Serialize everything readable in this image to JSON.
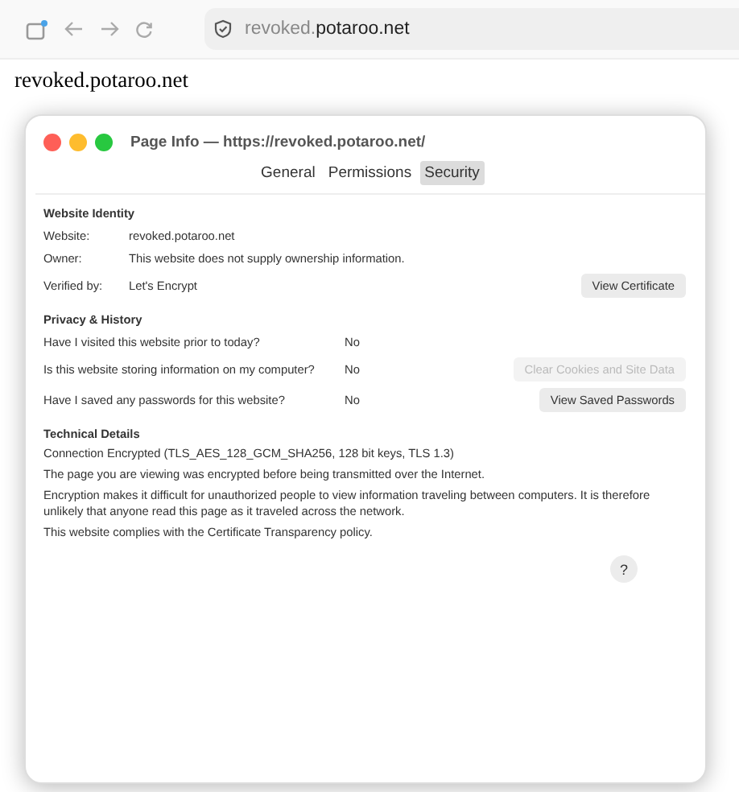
{
  "toolbar": {
    "address": "revoked.**potaroo.net**"
  },
  "page_heading": "revoked.potaroo.net",
  "dialog": {
    "title": "Page Info — https://revoked.potaroo.net/",
    "tabs": [
      {
        "label": "General",
        "selected": false
      },
      {
        "label": "Permissions",
        "selected": false
      },
      {
        "label": "Security",
        "selected": true
      }
    ],
    "identity": {
      "heading": "Website Identity",
      "rows": [
        {
          "label": "Website:",
          "value": "revoked.potaroo.net"
        },
        {
          "label": "Owner:",
          "value": "This website does not supply ownership information."
        },
        {
          "label": "Verified by:",
          "value": "Let's Encrypt",
          "button": {
            "label": "View Certificate",
            "disabled": false
          }
        }
      ]
    },
    "privacy": {
      "heading": "Privacy & History",
      "rows": [
        {
          "question": "Have I visited this website prior to today?",
          "answer": "No"
        },
        {
          "question": "Is this website storing information on my computer?",
          "answer": "No",
          "button": {
            "label": "Clear Cookies and Site Data",
            "disabled": true
          }
        },
        {
          "question": "Have I saved any passwords for this website?",
          "answer": "No",
          "button": {
            "label": "View Saved Passwords",
            "disabled": false
          }
        }
      ]
    },
    "technical": {
      "heading": "Technical Details",
      "lines": [
        "Connection Encrypted (TLS_AES_128_GCM_SHA256, 128 bit keys, TLS 1.3)",
        "The page you are viewing was encrypted before being transmitted over the Internet.",
        "Encryption makes it difficult for unauthorized people to view information traveling between computers. It is therefore unlikely that anyone read this page as it traveled across the network.",
        "This website complies with the Certificate Transparency policy."
      ]
    },
    "help": "?"
  }
}
